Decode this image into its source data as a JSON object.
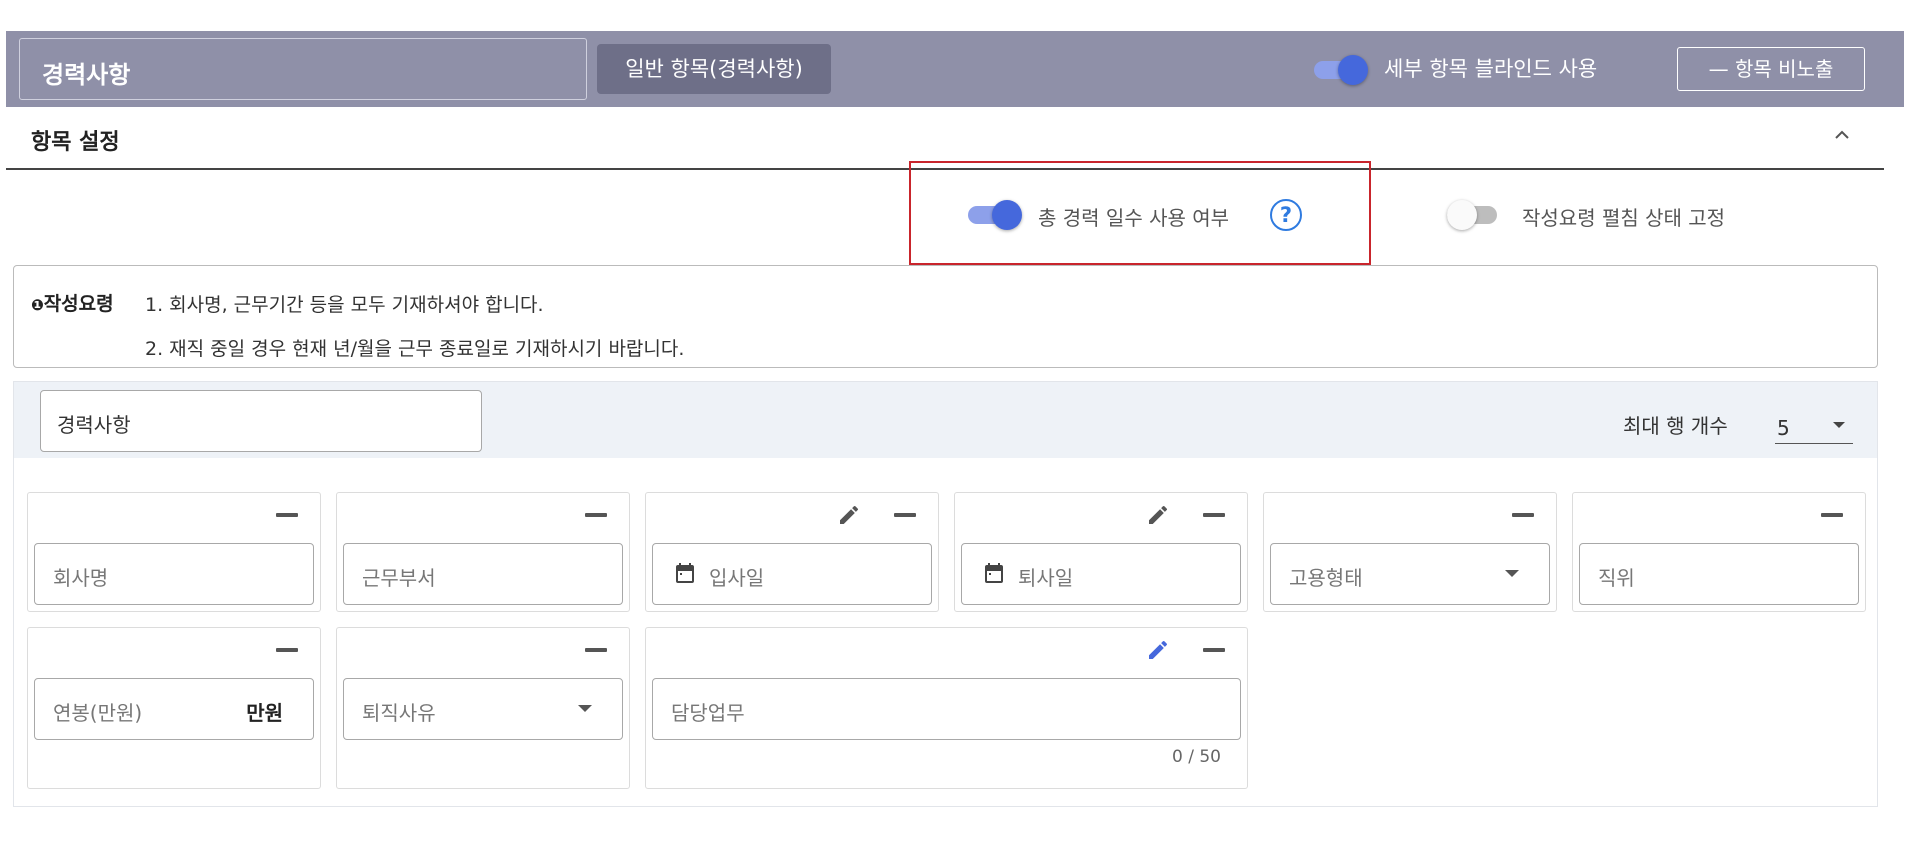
{
  "header": {
    "section_title": "경력사항",
    "type_chip": "일반 항목(경력사항)",
    "blind_label": "세부 항목 블라인드 사용",
    "hide_button": "— 항목 비노출"
  },
  "settings": {
    "label": "항목 설정",
    "career_days_label": "총 경력 일수 사용 여부",
    "help_symbol": "?",
    "guide_fixed_label": "작성요령 펼침 상태 고정"
  },
  "guide": {
    "bullet": "❶",
    "heading": "작성요령",
    "line1": "1. 회사명, 근무기간 등을 모두 기재하셔야 합니다.",
    "line2": "2. 재직 중일 경우 현재 년/월을 근무 종료일로 기재하시기 바랍니다."
  },
  "table": {
    "name": "경력사항",
    "max_rows_label": "최대 행 개수",
    "max_rows_value": "5",
    "fields": {
      "company": "회사명",
      "department": "근무부서",
      "join_date": "입사일",
      "leave_date": "퇴사일",
      "employment_type": "고용형태",
      "position": "직위",
      "salary": "연봉(만원)",
      "salary_unit": "만원",
      "leave_reason": "퇴직사유",
      "duty": "담당업무",
      "duty_count": "0 / 50"
    }
  },
  "colors": {
    "header_bg": "#8f90a8",
    "toggle_on": "#4568dc",
    "highlight_border": "#c9252c",
    "help_blue": "#2f7be0",
    "active_pencil": "#4568dc"
  },
  "icons": {
    "collapse": "chevron-up-icon",
    "remove": "minus-icon",
    "edit": "pencil-icon",
    "date": "calendar-icon",
    "help": "help-circle-icon",
    "dropdown": "caret-down-icon"
  }
}
